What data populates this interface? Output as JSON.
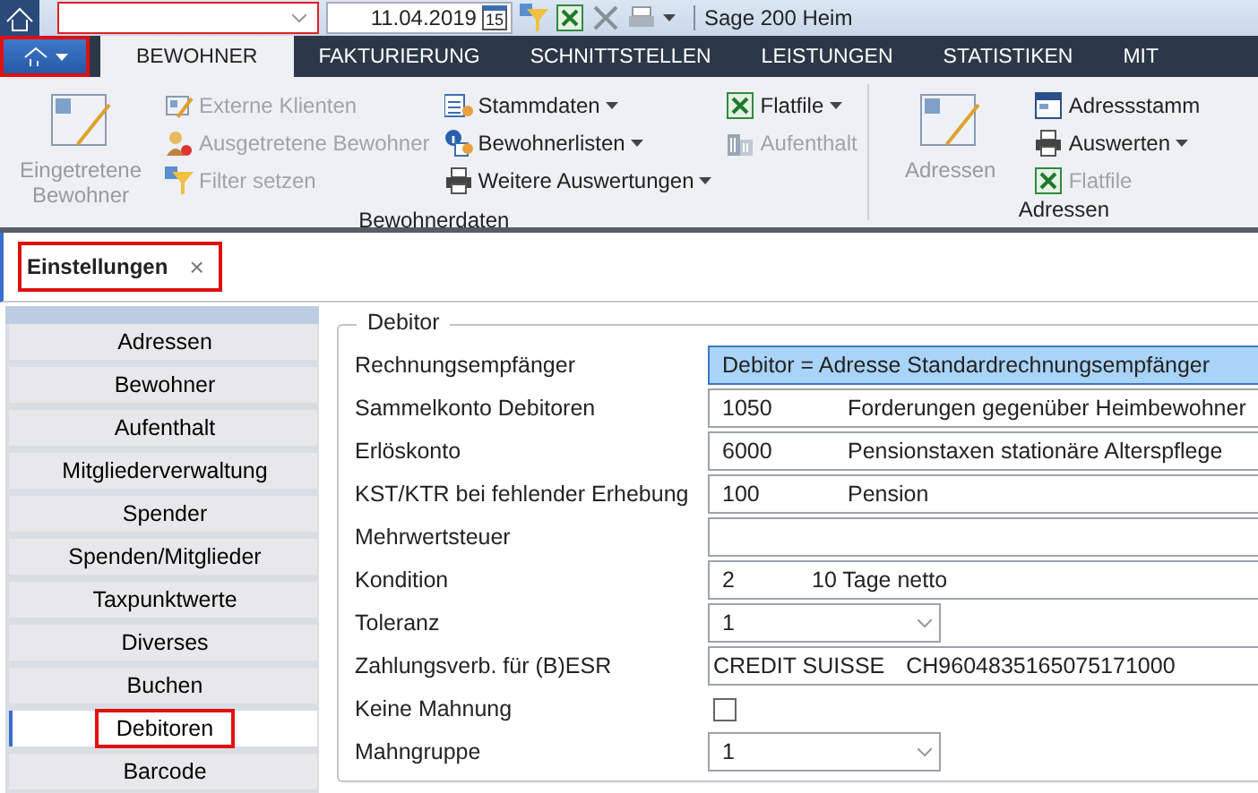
{
  "quick_access": {
    "date": "11.04.2019",
    "calendar_day": "15",
    "title": "Sage 200 Heim"
  },
  "ribbon": {
    "app_button": {
      "highlighted": true
    },
    "tabs": [
      {
        "label": "BEWOHNER",
        "selected": true
      },
      {
        "label": "FAKTURIERUNG",
        "selected": false
      },
      {
        "label": "SCHNITTSTELLEN",
        "selected": false
      },
      {
        "label": "LEISTUNGEN",
        "selected": false
      },
      {
        "label": "STATISTIKEN",
        "selected": false
      },
      {
        "label": "MIT",
        "selected": false
      }
    ],
    "groups": [
      {
        "title": "Bewohnerdaten",
        "large": {
          "label": "Eingetretene Bewohner",
          "disabled": true
        },
        "columns": [
          [
            {
              "label": "Externe Klienten",
              "disabled": true,
              "dropdown": false
            },
            {
              "label": "Ausgetretene Bewohner",
              "disabled": true,
              "dropdown": false
            },
            {
              "label": "Filter setzen",
              "disabled": true,
              "dropdown": false
            }
          ],
          [
            {
              "label": "Stammdaten",
              "disabled": false,
              "dropdown": true
            },
            {
              "label": "Bewohnerlisten",
              "disabled": false,
              "dropdown": true
            },
            {
              "label": "Weitere Auswertungen",
              "disabled": false,
              "dropdown": true
            }
          ],
          [
            {
              "label": "Flatfile",
              "disabled": false,
              "dropdown": true
            },
            {
              "label": "Aufenthalt",
              "disabled": true,
              "dropdown": false
            }
          ]
        ]
      },
      {
        "title": "Adressen",
        "large": {
          "label": "Adressen",
          "disabled": true
        },
        "columns": [
          [
            {
              "label": "Adressstamm",
              "disabled": false,
              "dropdown": false
            },
            {
              "label": "Auswerten",
              "disabled": false,
              "dropdown": true
            },
            {
              "label": "Flatfile",
              "disabled": true,
              "dropdown": false
            }
          ]
        ]
      }
    ]
  },
  "document_tabs": [
    {
      "label": "Einstellungen",
      "close": "×",
      "selected": true,
      "highlighted": true
    }
  ],
  "nav": [
    {
      "label": "Adressen",
      "selected": false,
      "highlighted": false
    },
    {
      "label": "Bewohner",
      "selected": false,
      "highlighted": false
    },
    {
      "label": "Aufenthalt",
      "selected": false,
      "highlighted": false
    },
    {
      "label": "Mitgliederverwaltung",
      "selected": false,
      "highlighted": false
    },
    {
      "label": "Spender",
      "selected": false,
      "highlighted": false
    },
    {
      "label": "Spenden/Mitglieder",
      "selected": false,
      "highlighted": false
    },
    {
      "label": "Taxpunktwerte",
      "selected": false,
      "highlighted": false
    },
    {
      "label": "Diverses",
      "selected": false,
      "highlighted": false
    },
    {
      "label": "Buchen",
      "selected": false,
      "highlighted": false
    },
    {
      "label": "Debitoren",
      "selected": true,
      "highlighted": true
    },
    {
      "label": "Barcode",
      "selected": false,
      "highlighted": false
    }
  ],
  "groupbox": {
    "title": "Debitor",
    "rows": [
      {
        "label": "Rechnungsempfänger",
        "kind": "select",
        "value": "Debitor = Adresse Standardrechnungsempfänger",
        "selected": true
      },
      {
        "label": "Sammelkonto Debitoren",
        "kind": "code",
        "code": "1050",
        "description": "Forderungen gegenüber Heimbewohner"
      },
      {
        "label": "Erlöskonto",
        "kind": "code",
        "code": "6000",
        "description": "Pensionstaxen stationäre Alterspflege"
      },
      {
        "label": "KST/KTR bei fehlender Erhebung",
        "kind": "code",
        "code": "100",
        "description": "Pension"
      },
      {
        "label": "Mehrwertsteuer",
        "kind": "text"
      },
      {
        "label": "Kondition",
        "kind": "code_short",
        "code": "2",
        "description": "10 Tage netto"
      },
      {
        "label": "Toleranz",
        "kind": "dropdown",
        "value": "1"
      },
      {
        "label": "Zahlungsverb. für (B)ESR",
        "kind": "bank",
        "bank": "CREDIT SUISSE",
        "account": "CH9604835165075171000"
      },
      {
        "label": "Keine Mahnung",
        "kind": "checkbox",
        "checked": false
      },
      {
        "label": "Mahngruppe",
        "kind": "dropdown",
        "value": "1"
      }
    ]
  }
}
